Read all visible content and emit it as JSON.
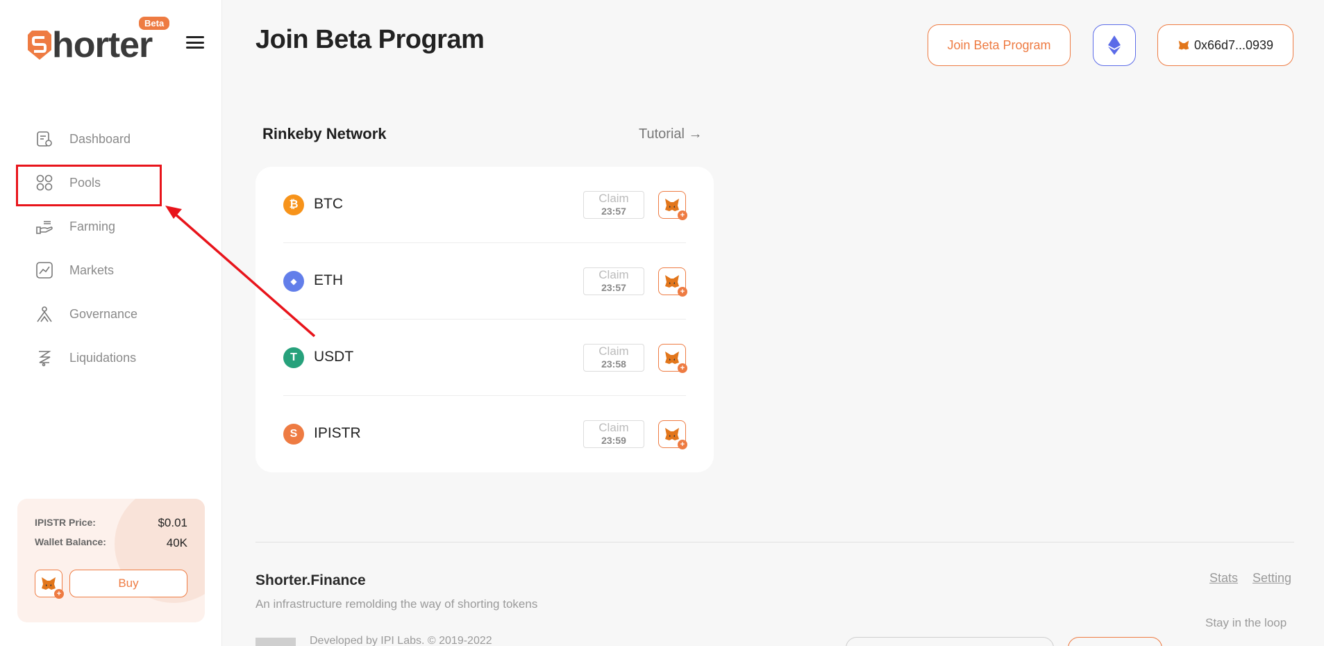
{
  "sidebar": {
    "logo_text": "horter",
    "beta": "Beta",
    "nav": [
      {
        "label": "Dashboard",
        "icon": "dashboard-icon"
      },
      {
        "label": "Pools",
        "icon": "pools-icon"
      },
      {
        "label": "Farming",
        "icon": "farming-icon"
      },
      {
        "label": "Markets",
        "icon": "markets-icon"
      },
      {
        "label": "Governance",
        "icon": "governance-icon"
      },
      {
        "label": "Liquidations",
        "icon": "liquidations-icon"
      }
    ],
    "price_card": {
      "price_label": "IPISTR Price:",
      "price_value": "$0.01",
      "balance_label": "Wallet Balance:",
      "balance_value": "40K",
      "buy_label": "Buy"
    }
  },
  "header": {
    "title": "Join Beta Program",
    "join_button": "Join Beta Program",
    "wallet_address": "0x66d7...0939"
  },
  "faucet": {
    "network_title": "Rinkeby Network",
    "tutorial": "Tutorial →",
    "tokens": [
      {
        "name": "BTC",
        "claim": "Claim",
        "time": "23:57",
        "color": "#f7931a",
        "glyph": "₿"
      },
      {
        "name": "ETH",
        "claim": "Claim",
        "time": "23:57",
        "color": "#627eea",
        "glyph": "◆"
      },
      {
        "name": "USDT",
        "claim": "Claim",
        "time": "23:58",
        "color": "#26a17b",
        "glyph": "T"
      },
      {
        "name": "IPISTR",
        "claim": "Claim",
        "time": "23:59",
        "color": "#ee7b42",
        "glyph": "S"
      }
    ]
  },
  "footer": {
    "brand": "Shorter.Finance",
    "tagline": "An infrastructure remolding the way of shorting tokens",
    "stats": "Stats",
    "setting": "Setting",
    "stay": "Stay in the loop",
    "developed": "Developed by IPI Labs. © 2019-2022"
  },
  "colors": {
    "accent": "#ee7b42",
    "eth_blue": "#5b6be8",
    "annotation_red": "#e8141b"
  }
}
